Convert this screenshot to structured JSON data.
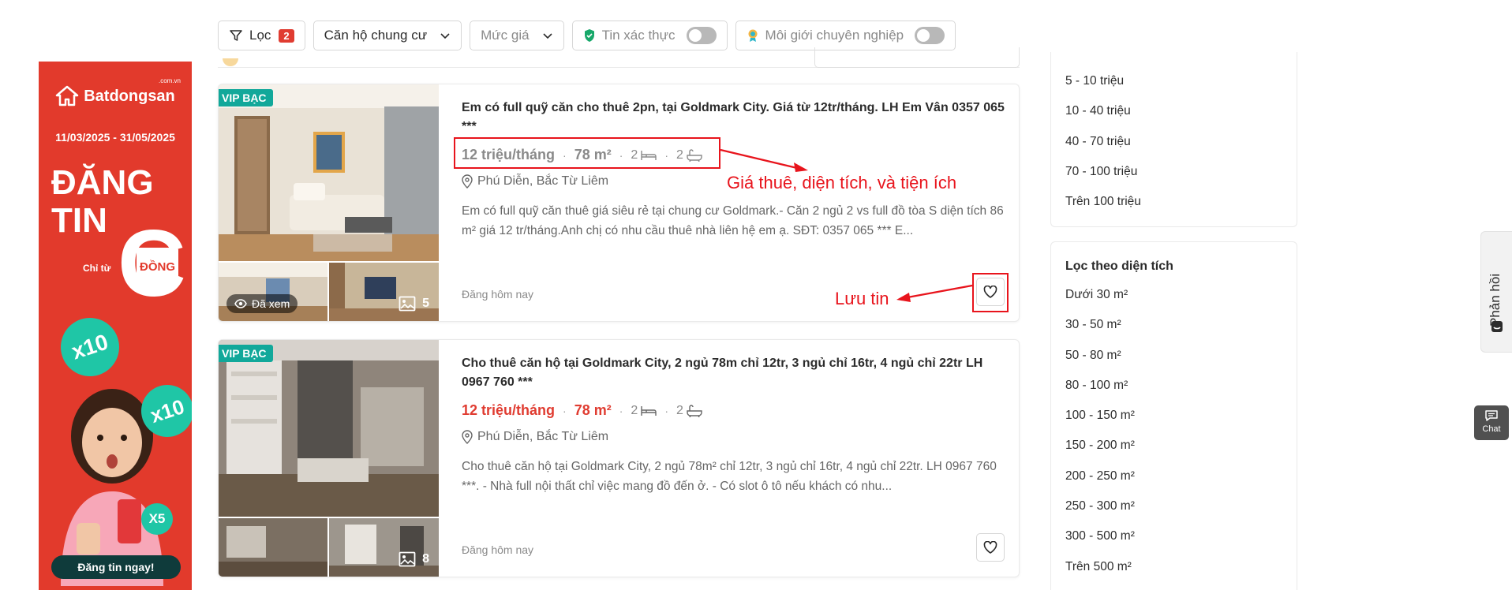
{
  "filters": {
    "filter_label": "Lọc",
    "filter_count": "2",
    "property_type": "Căn hộ chung cư",
    "price": "Mức giá",
    "verified": "Tin xác thực",
    "pro_broker": "Môi giới chuyên nghiệp"
  },
  "ad": {
    "brand": "Batdongsan",
    "brand_domain": ".com.vn",
    "dates": "11/03/2025 - 31/05/2025",
    "headline_1": "ĐĂNG",
    "headline_2": "TIN",
    "big_c": "C",
    "from_label": "Chỉ từ",
    "currency": "ĐỒNG",
    "badge_1": "x10",
    "badge_2": "x10",
    "badge_3": "X5",
    "cta": "Đăng tin ngay!"
  },
  "listings": [
    {
      "badge": "VIP BẠC",
      "title": "Em có full quỹ căn cho thuê 2pn, tại Goldmark City. Giá từ 12tr/tháng. LH Em Vân 0357 065 ***",
      "price": "12 triệu/tháng",
      "area": "78 m²",
      "beds": "2",
      "baths": "2",
      "location": "Phú Diễn, Bắc Từ Liêm",
      "description": "Em có full quỹ căn thuê giá siêu rẻ tại chung cư Goldmark.- Căn 2 ngủ 2 vs full đồ tòa S diện tích 86 m² giá 12 tr/tháng.Anh chị có nhu cầu thuê nhà liên hệ em ạ. SĐT: 0357 065 *** E...",
      "seen": "Đã xem",
      "photos": "5",
      "posted": "Đăng hôm nay"
    },
    {
      "badge": "VIP BẠC",
      "title": "Cho thuê căn hộ tại Goldmark City, 2 ngủ 78m chỉ 12tr, 3 ngủ chỉ 16tr, 4 ngủ chỉ 22tr LH 0967 760 ***",
      "price": "12 triệu/tháng",
      "area": "78 m²",
      "beds": "2",
      "baths": "2",
      "location": "Phú Diễn, Bắc Từ Liêm",
      "description": "Cho thuê căn hộ tại Goldmark City, 2 ngủ 78m² chỉ 12tr, 3 ngủ chỉ 16tr, 4 ngủ chỉ 22tr. LH 0967 760 ***. - Nhà full nội thất chỉ việc mang đồ đến ở. - Có slot ô tô nếu khách có nhu...",
      "photos": "8",
      "posted": "Đăng hôm nay"
    }
  ],
  "sep": "·",
  "price_filter": {
    "items": [
      "5 - 10 triệu",
      "10 - 40 triệu",
      "40 - 70 triệu",
      "70 - 100 triệu",
      "Trên 100 triệu"
    ]
  },
  "area_filter": {
    "title": "Lọc theo diện tích",
    "items": [
      "Dưới 30 m²",
      "30 - 50 m²",
      "50 - 80 m²",
      "80 - 100 m²",
      "100 - 150 m²",
      "150 - 200 m²",
      "200 - 250 m²",
      "250 - 300 m²",
      "300 - 500 m²",
      "Trên 500 m²"
    ]
  },
  "feedback_label": "Phản hồi",
  "chat_label": "Chat",
  "annotations": {
    "details": "Giá thuê, diện tích, và tiện ích",
    "save": "Lưu tin"
  },
  "colors": {
    "accent": "#e03c31",
    "vip": "#12a89a",
    "annotation": "#e8141c"
  }
}
